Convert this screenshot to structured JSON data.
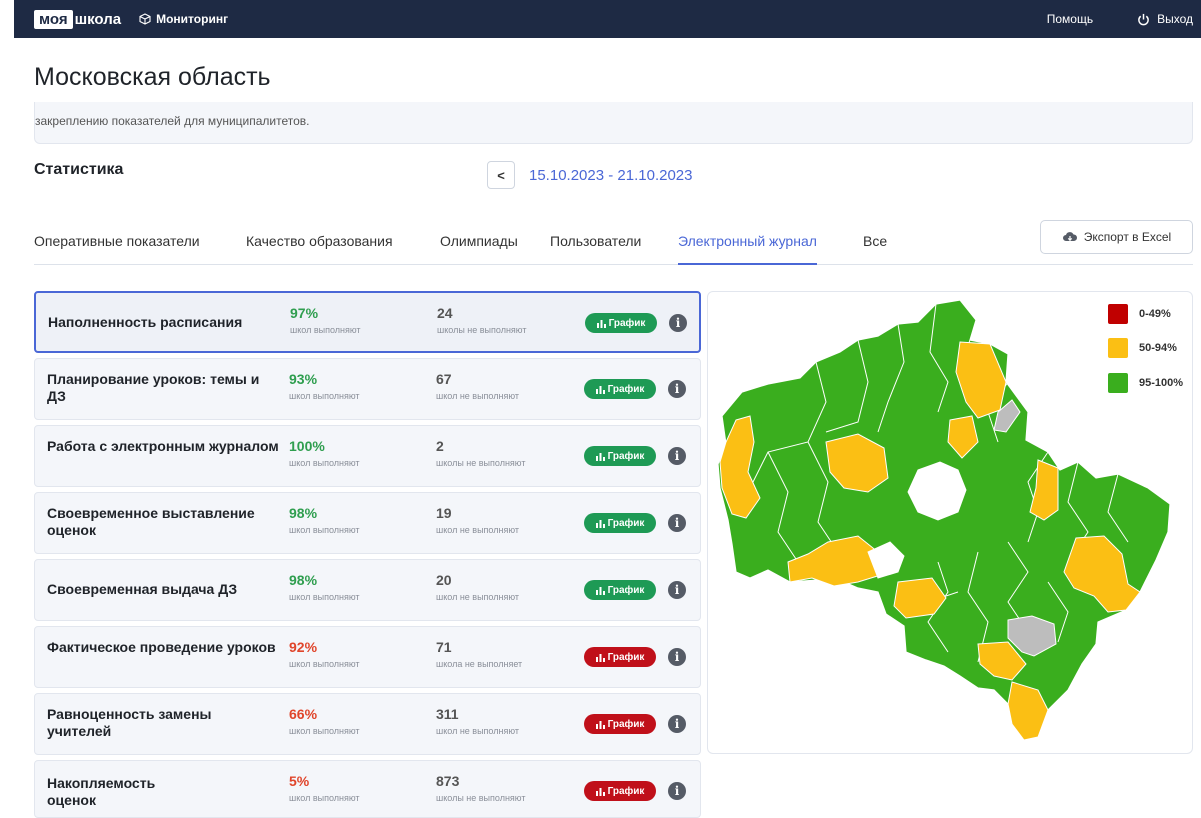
{
  "header": {
    "logo_part1": "моя",
    "logo_part2": "школа",
    "monitoring": "Мониторинг",
    "help": "Помощь",
    "exit": "Выход"
  },
  "page": {
    "title": "Московская область",
    "info_text": "закреплению показателей для муниципалитетов."
  },
  "stats": {
    "title": "Статистика",
    "prev_button": "<",
    "date_range": "15.10.2023 - 21.10.2023"
  },
  "tabs": [
    {
      "label": "Оперативные показатели",
      "active": false
    },
    {
      "label": "Качество образования",
      "active": false
    },
    {
      "label": "Олимпиады",
      "active": false
    },
    {
      "label": "Пользователи",
      "active": false
    },
    {
      "label": "Электронный журнал",
      "active": true
    },
    {
      "label": "Все",
      "active": false
    }
  ],
  "export_label": "Экспорт в Excel",
  "graph_label": "График",
  "info_icon": "i",
  "metrics": [
    {
      "name": "Наполненность расписания",
      "pct": "97%",
      "pct_label": "школ выполняют",
      "count": "24",
      "count_label": "школы не выполняют",
      "status": "green"
    },
    {
      "name": "Планирование уроков: темы и ДЗ",
      "pct": "93%",
      "pct_label": "школ выполняют",
      "count": "67",
      "count_label": "школ не выполняют",
      "status": "green"
    },
    {
      "name": "Работа с электронным журналом",
      "pct": "100%",
      "pct_label": "школ выполняют",
      "count": "2",
      "count_label": "школы не выполняют",
      "status": "green"
    },
    {
      "name": "Своевременное выставление оценок",
      "pct": "98%",
      "pct_label": "школ выполняют",
      "count": "19",
      "count_label": "школ не выполняют",
      "status": "green"
    },
    {
      "name": "Своевременная выдача ДЗ",
      "pct": "98%",
      "pct_label": "школ выполняют",
      "count": "20",
      "count_label": "школ не выполняют",
      "status": "green"
    },
    {
      "name": "Фактическое проведение уроков",
      "pct": "92%",
      "pct_label": "школ выполняют",
      "count": "71",
      "count_label": "школа не выполняет",
      "status": "red"
    },
    {
      "name": "Равноценность замены учителей",
      "pct": "66%",
      "pct_label": "школ выполняют",
      "count": "311",
      "count_label": "школ не выполняют",
      "status": "red"
    },
    {
      "name": "Накопляемость оценок",
      "pct": "5%",
      "pct_label": "школ выполняют",
      "count": "873",
      "count_label": "школы не выполняют",
      "status": "red"
    }
  ],
  "legend": [
    {
      "label": "0-49%",
      "color": "#c00000"
    },
    {
      "label": "50-94%",
      "color": "#fbbf14"
    },
    {
      "label": "95-100%",
      "color": "#3aae1e"
    }
  ],
  "colors": {
    "green": "#3aae1e",
    "yellow": "#fbbf14",
    "red": "#c00000",
    "grey": "#bdbdbd",
    "badge_green": "#1e9a55",
    "badge_red": "#c0101a",
    "pct_green": "#2f9e4f",
    "pct_red": "#e0452b",
    "accent": "#4a67d6",
    "header_bg": "#1e2a44"
  }
}
